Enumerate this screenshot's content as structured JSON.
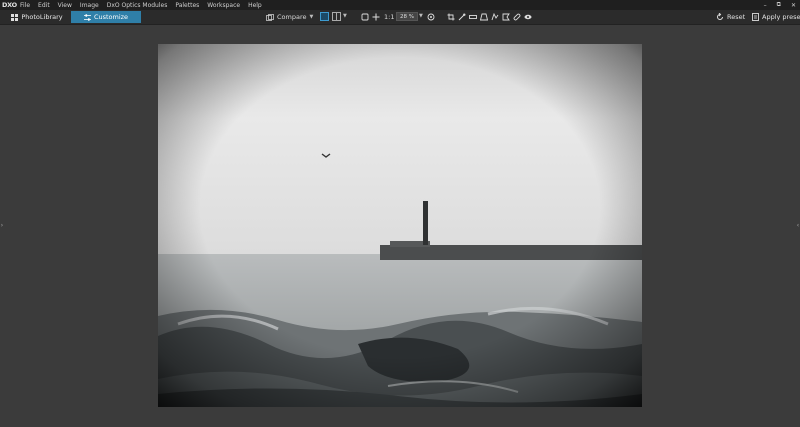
{
  "menubar": {
    "logo": "DXO",
    "items": [
      "File",
      "Edit",
      "View",
      "Image",
      "DxO Optics Modules",
      "Palettes",
      "Workspace",
      "Help"
    ],
    "window_controls": {
      "minimize": "–",
      "restore": "⧉",
      "close": "✕"
    }
  },
  "toolbar": {
    "tabs": {
      "photolibrary": "PhotoLibrary",
      "customize": "Customize"
    },
    "active_tab": "Customize",
    "compare_label": "Compare",
    "zoom_1to1": "1:1",
    "zoom_value": "28 %",
    "reset_label": "Reset",
    "apply_preset_label": "Apply preset"
  },
  "icons": {
    "photolibrary": "grid-icon",
    "customize": "sliders-icon",
    "compare": "compare-icon",
    "fit": "fit-screen-icon",
    "pan": "move-icon",
    "crop": "crop-icon",
    "eyedropper": "eyedropper-icon",
    "horizon": "horizon-icon",
    "perspective": "perspective-icon",
    "local-adjust": "local-adjust-icon",
    "repair": "repair-icon",
    "redeye": "eye-icon",
    "reset": "reset-icon",
    "preset": "preset-icon"
  },
  "colors": {
    "accent": "#2f7fa8",
    "background": "#3b3b3b",
    "menubar": "#1f1f1f",
    "toolbar": "#2b2b2b"
  }
}
